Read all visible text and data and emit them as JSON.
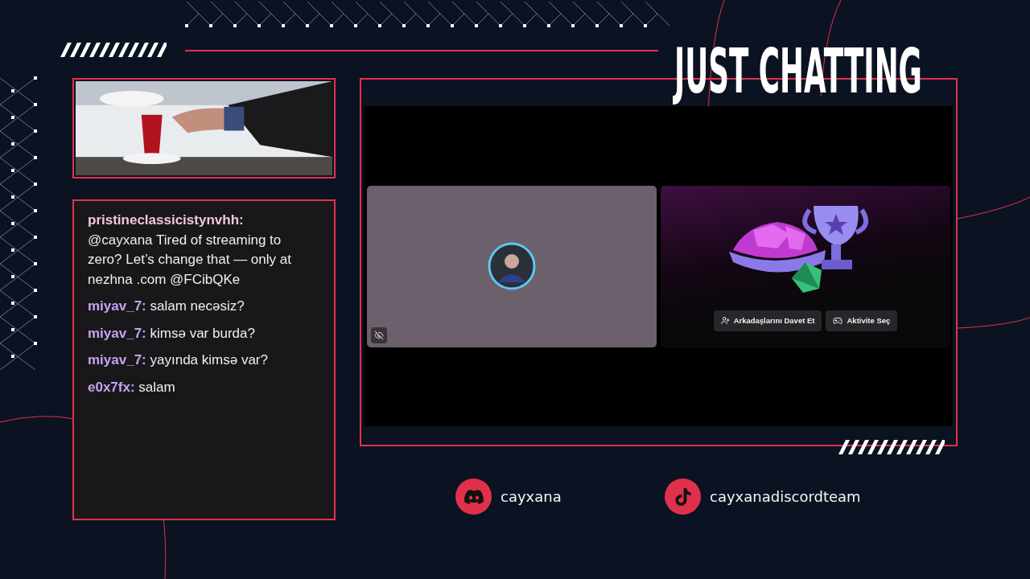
{
  "scene_title": "JUST CHATTING",
  "chat": {
    "messages": [
      {
        "user": "pristineclassicistynvhh:",
        "text": "@cayxana Tired of streaming to zero? Let’s change that — only at nezhna .com @FCibQKe",
        "color": "#eec6dc"
      },
      {
        "user": "miyav_7:",
        "text": "salam necəsiz?",
        "color": "#c9a2f2"
      },
      {
        "user": "miyav_7:",
        "text": "kimsə var burda?",
        "color": "#c9a2f2"
      },
      {
        "user": "miyav_7:",
        "text": "yayında kimsə var?",
        "color": "#c9a2f2"
      },
      {
        "user": "e0x7fx:",
        "text": "salam",
        "color": "#c9a2f2"
      }
    ]
  },
  "stream": {
    "tiles": [
      {
        "kind": "camera"
      },
      {
        "kind": "activity",
        "buttons": [
          {
            "kind": "invite",
            "label": "Arkadaşlarını Davet Et"
          },
          {
            "kind": "activity",
            "label": "Aktivite Seç"
          }
        ]
      }
    ]
  },
  "socials": [
    {
      "kind": "discord",
      "handle": "cayxana"
    },
    {
      "kind": "tiktok",
      "handle": "cayxanadiscordteam"
    }
  ]
}
